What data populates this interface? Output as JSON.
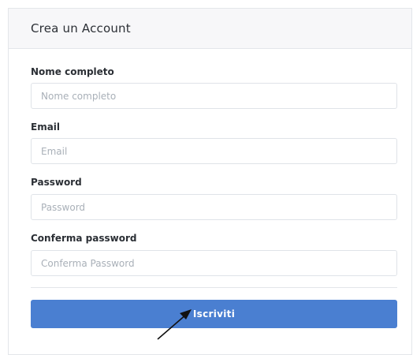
{
  "card": {
    "title": "Crea un Account"
  },
  "form": {
    "full_name": {
      "label": "Nome completo",
      "placeholder": "Nome completo",
      "value": ""
    },
    "email": {
      "label": "Email",
      "placeholder": "Email",
      "value": ""
    },
    "password": {
      "label": "Password",
      "placeholder": "Password",
      "value": ""
    },
    "confirm_password": {
      "label": "Conferma password",
      "placeholder": "Conferma Password",
      "value": ""
    },
    "submit_label": "Iscriviti"
  },
  "colors": {
    "primary": "#4a7fd1",
    "header_bg": "#f7f7f9",
    "border": "#e3e6ea"
  }
}
